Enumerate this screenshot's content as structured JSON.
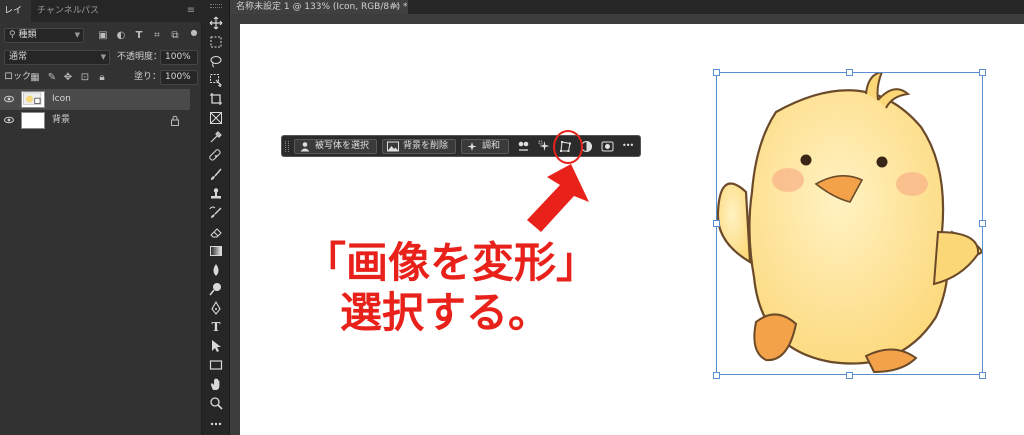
{
  "panel": {
    "tabs": [
      "レイヤー",
      "チャンネル",
      "パス"
    ],
    "filter_label": "種類",
    "blend_mode": "通常",
    "opacity_label": "不透明度：",
    "opacity_value": "100%",
    "lock_label": "ロック：",
    "fill_label": "塗り：",
    "fill_value": "100%",
    "layers": [
      {
        "name": "Icon",
        "selected": true
      },
      {
        "name": "背景",
        "selected": false,
        "locked": true
      }
    ]
  },
  "document": {
    "tab_title": "名称未設定 1 @ 133% (Icon, RGB/8#) *",
    "close_glyph": "×"
  },
  "taskbar": {
    "select_subject": "被写体を選択",
    "remove_background": "背景を削除",
    "harmonize": "調和",
    "more_glyph": "•••"
  },
  "annotation": {
    "line1": "「画像を変形」",
    "line2": "選択する。",
    "color": "#e8221b"
  },
  "colors": {
    "panel_bg": "#323232",
    "toolbar_bg": "#262626",
    "selection_blue": "#5a8fd0",
    "chick_body": "#fde7a0"
  }
}
